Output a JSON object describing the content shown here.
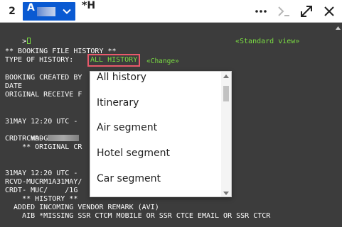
{
  "toolbar": {
    "tab_index": "2",
    "session_label": "A",
    "command_tab": "*H",
    "icons": [
      "more-icon",
      "command-prompt-icon",
      "expand-icon",
      "close-icon"
    ]
  },
  "terminal": {
    "prompt": ">",
    "standard_view": "«Standard view»",
    "header": "** BOOKING FILE HISTORY **",
    "type_label": "TYPE OF HISTORY:",
    "type_value": "ALL HISTORY",
    "change_link": "«Change»",
    "line_created": "BOOKING CREATED BY",
    "line_date": "DATE",
    "line_original": "ORIGINAL RECEIVE F",
    "block1_time": "31MAY 12:20 UTC -",
    "block1_rcvd": "RCVD-G",
    "block1_crdt": "CRDT- MAD",
    "block1_orig": "    ** ORIGINAL CR",
    "block2_time": "31MAY 12:20 UTC -",
    "block2_rcvd": "RCVD-MUCRM1A31MAY/",
    "block2_crdt": "CRDT- MUC/    /1G",
    "block2_hist": "    ** HISTORY **",
    "block2_added": "  ADDED INCOMING VENDOR REMARK (AVI)",
    "block2_aib": "    AIB *MISSING SSR CTCM MOBILE OR SSR CTCE EMAIL OR SSR CTCR"
  },
  "dropdown": {
    "options": [
      "All history",
      "Itinerary",
      "Air segment",
      "Hotel segment",
      "Car segment"
    ]
  },
  "colors": {
    "terminal_bg": "#3c3c3c",
    "terminal_text": "#ffffff",
    "accent_green": "#7bdd43",
    "session_blue": "#0a5ad2",
    "highlight_red": "#e8596a"
  }
}
